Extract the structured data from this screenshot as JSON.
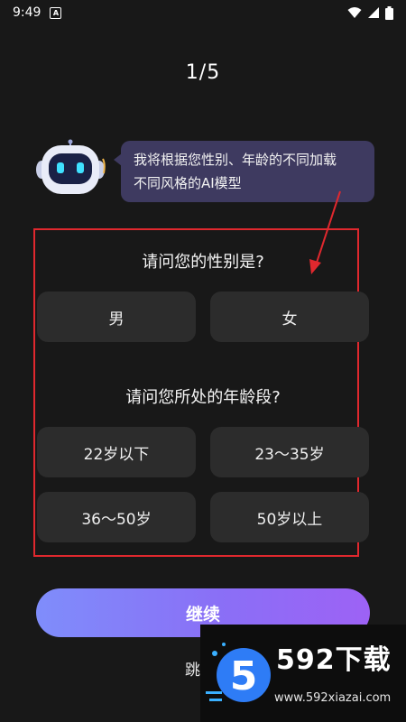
{
  "status_bar": {
    "time": "9:49"
  },
  "progress": "1/5",
  "bubble": {
    "line1": "我将根据您性别、年龄的不同加载",
    "line2": "不同风格的AI模型"
  },
  "gender": {
    "question": "请问您的性别是?",
    "options": [
      "男",
      "女"
    ]
  },
  "age": {
    "question": "请问您所处的年龄段?",
    "options": [
      "22岁以下",
      "23～35岁",
      "36～50岁",
      "50岁以上"
    ]
  },
  "continue_label": "继续",
  "skip_label": "跳",
  "watermark": {
    "brand": "592下载",
    "url": "www.592xiazai.com"
  },
  "colors": {
    "background": "#181818",
    "option_bg": "#2c2c2c",
    "bubble_bg": "#3e3a60",
    "annotation_red": "#e0282e",
    "button_gradient_start": "#7f8dfb",
    "button_gradient_end": "#9d62f5"
  },
  "icons": [
    "notification-icon",
    "wifi-icon",
    "signal-icon",
    "battery-icon",
    "robot-avatar-icon"
  ]
}
